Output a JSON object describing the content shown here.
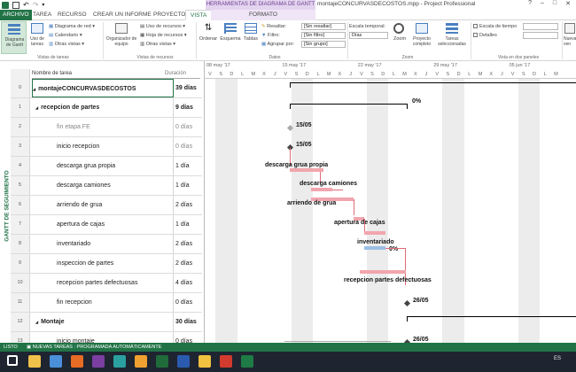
{
  "window": {
    "context_tab_title": "HERRAMIENTAS DE DIAGRAMA DE GANTT",
    "title": "montajeCONCURVASDECOSTOS.mpp - Project Professional",
    "controls": [
      "?",
      "–",
      "□",
      "✕"
    ]
  },
  "tabs": [
    "ARCHIVO",
    "TAREA",
    "RECURSO",
    "CREAR UN INFORME",
    "PROYECTO",
    "VISTA",
    "FORMATO"
  ],
  "ribbon": {
    "gantt_button": "Diagrama de Gantt",
    "task_usage": "Uso de tareas",
    "network_diagram": "Diagrama de red",
    "calendar": "Calendario",
    "other_views": "Otras vistas",
    "team_planner": "Organizador de equipo",
    "resource_usage": "Uso de recursos",
    "resource_sheet": "Hoja de recursos",
    "other_views2": "Otras vistas",
    "sort": "Ordenar",
    "outline": "Esquema",
    "tables": "Tablas",
    "highlight_label": "Resaltar:",
    "highlight_value": "[Sin resaltar]",
    "filter_label": "Filtro:",
    "filter_value": "[Sin filtro]",
    "group_label": "Agrupar por:",
    "group_value": "[Sin grupo]",
    "timescale_label": "Escala temporal:",
    "timescale_value": "Días",
    "zoom": "Zoom",
    "full_project": "Proyecto completo",
    "selected_tasks": "Tareas seleccionadas",
    "timeline": "Escala de tiempo",
    "details": "Detalles",
    "new_window": "Nueva ven",
    "group_task_views": "Vistas de tareas",
    "group_resource_views": "Vistas de recursos",
    "group_data": "Datos",
    "group_zoom": "Zoom",
    "group_split": "Vista en dos paneles"
  },
  "table": {
    "header_name": "Nombre de tarea",
    "header_duration": "Duración",
    "side_label": "GANTT DE SEGUIMIENTO",
    "rows": [
      {
        "id": "0",
        "name": "montajeCONCURVASDECOSTOS",
        "duration": "39 días",
        "type": "project"
      },
      {
        "id": "1",
        "name": "recepcion de partes",
        "duration": "9 días",
        "type": "summary"
      },
      {
        "id": "2",
        "name": "fin etapa FE",
        "duration": "0 días",
        "type": "milestone"
      },
      {
        "id": "3",
        "name": "inicio recepcion",
        "duration": "0 días",
        "type": "milestone"
      },
      {
        "id": "4",
        "name": "descarga grua propia",
        "duration": "1 día",
        "type": "task"
      },
      {
        "id": "5",
        "name": "descarga camiones",
        "duration": "1 día",
        "type": "task"
      },
      {
        "id": "6",
        "name": "arriendo de grua",
        "duration": "2 días",
        "type": "task"
      },
      {
        "id": "7",
        "name": "apertura de cajas",
        "duration": "1 día",
        "type": "task"
      },
      {
        "id": "8",
        "name": "inventariado",
        "duration": "2 días",
        "type": "task"
      },
      {
        "id": "9",
        "name": "inspeccion de partes",
        "duration": "2 días",
        "type": "task"
      },
      {
        "id": "10",
        "name": "recepcion partes defectuosas",
        "duration": "4 días",
        "type": "task"
      },
      {
        "id": "11",
        "name": "fin recepcion",
        "duration": "0 días",
        "type": "milestone"
      },
      {
        "id": "12",
        "name": "Montaje",
        "duration": "30 días",
        "type": "summary"
      },
      {
        "id": "13",
        "name": "inicio montaje",
        "duration": "0 días",
        "type": "milestone"
      }
    ]
  },
  "gantt": {
    "weeks": [
      "08 may '17",
      "15 may '17",
      "22 may '17",
      "29 may '17",
      "05 jun '17"
    ],
    "days": [
      "V",
      "S",
      "D",
      "L",
      "M",
      "X",
      "J",
      "V",
      "S",
      "D",
      "L",
      "M",
      "X",
      "J",
      "V",
      "S",
      "D",
      "L",
      "M",
      "X",
      "J",
      "V",
      "S",
      "D",
      "L",
      "M",
      "X",
      "J",
      "V",
      "S",
      "D",
      "L",
      "M"
    ],
    "labels": {
      "pct0": "0%",
      "m1505a": "15/05",
      "m1505b": "15/05",
      "t4": "descarga grua propia",
      "t5": "descarga camiones",
      "t6": "arriendo de grua",
      "t7": "apertura de cajas",
      "t8": "inventariado",
      "t8pct": "0%",
      "t10": "recepcion partes defectuosas",
      "m2605a": "26/05",
      "m2605b": "26/05"
    }
  },
  "status": {
    "ready": "LISTO",
    "new_tasks": "NUEVAS TAREAS : PROGRAMADA AUTOMÁTICAMENTE"
  },
  "taskbar": {
    "apps": [
      "windows",
      "files",
      "chrome",
      "firefox",
      "onenote",
      "app",
      "search",
      "project",
      "word",
      "explorer",
      "acrobat",
      "excel"
    ],
    "tray": "ES"
  },
  "colors": {
    "accent": "#217346",
    "bar": "#f2a5ad",
    "progress": "#9bbfe6",
    "context": "#e4d4ef"
  }
}
